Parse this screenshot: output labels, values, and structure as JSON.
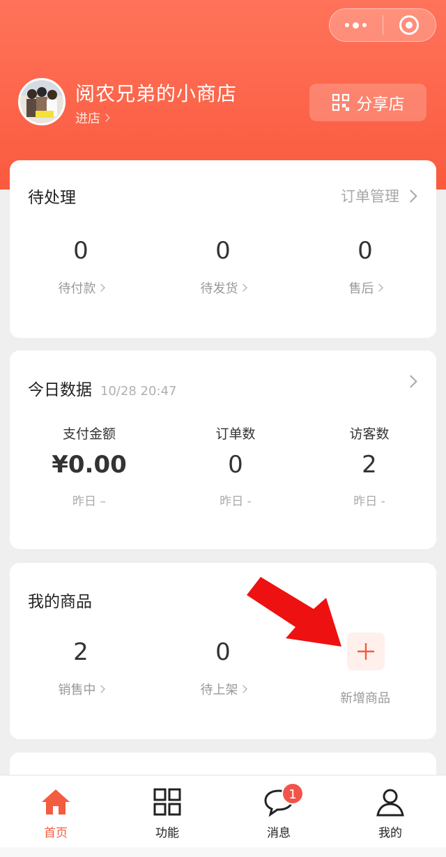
{
  "capsule": {
    "more_icon": "more-dots-icon",
    "close_icon": "close-target-icon"
  },
  "header": {
    "shop_name": "阅农兄弟的小商店",
    "enter_label": "进店",
    "share_label": "分享店",
    "share_icon": "qrcode-icon"
  },
  "pending": {
    "title": "待处理",
    "link_label": "订单管理",
    "stats": [
      {
        "value": "0",
        "label": "待付款"
      },
      {
        "value": "0",
        "label": "待发货"
      },
      {
        "value": "0",
        "label": "售后"
      }
    ]
  },
  "today": {
    "title": "今日数据",
    "timestamp": "10/28 20:47",
    "stats": [
      {
        "label": "支付金额",
        "value": "¥0.00",
        "compare": "昨日 –"
      },
      {
        "label": "订单数",
        "value": "0",
        "compare": "昨日 -"
      },
      {
        "label": "访客数",
        "value": "2",
        "compare": "昨日 -"
      }
    ]
  },
  "products": {
    "title": "我的商品",
    "stats": [
      {
        "value": "2",
        "label": "销售中"
      },
      {
        "value": "0",
        "label": "待上架"
      }
    ],
    "add_label": "新增商品"
  },
  "tabbar": {
    "items": [
      {
        "label": "首页",
        "icon": "home-icon",
        "active": true
      },
      {
        "label": "功能",
        "icon": "grid-icon",
        "active": false
      },
      {
        "label": "消息",
        "icon": "chat-bubble-icon",
        "active": false
      },
      {
        "label": "我的",
        "icon": "user-icon",
        "active": false
      }
    ],
    "message_badge": "1"
  },
  "colors": {
    "brand": "#fa5a3e",
    "accent_red": "#f1544b",
    "annotation_arrow": "#ee1111"
  }
}
